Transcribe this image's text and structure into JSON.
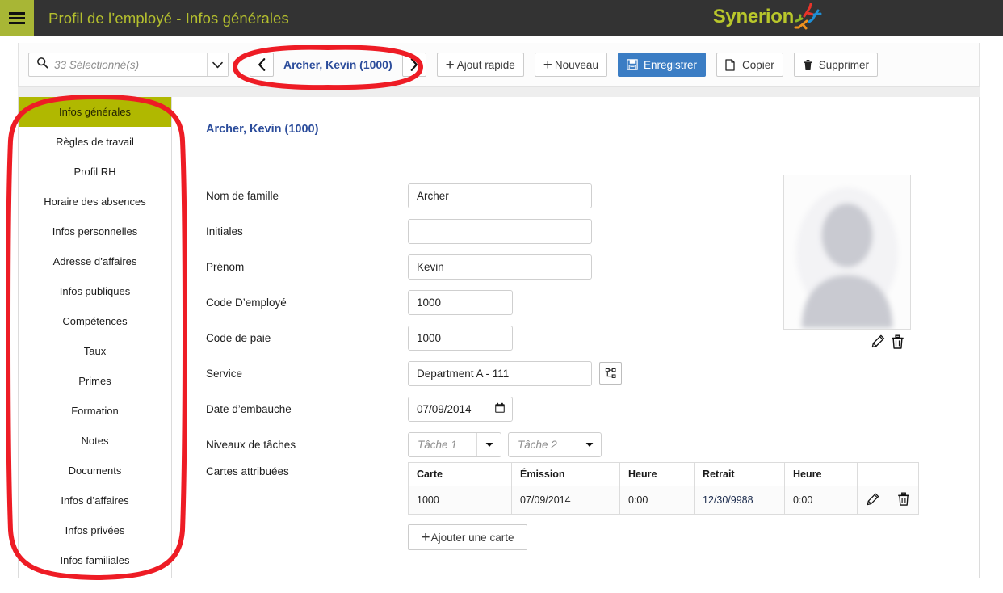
{
  "header": {
    "title": "Profil de l’employé - Infos générales",
    "menu_icon": "hamburger-icon",
    "logo_text": "Synerion",
    "colors": {
      "bar": "#333333",
      "accent": "#b0b800",
      "title_text": "#b4bf2e"
    }
  },
  "toolbar": {
    "search": {
      "placeholder": "33 Sélectionné(s)",
      "value": "",
      "icon": "search-icon"
    },
    "nav": {
      "prev_label": "‹",
      "next_label": "›",
      "employee": "Archer, Kevin (1000)"
    },
    "buttons": [
      {
        "label": "Ajout rapide",
        "icon": "plus-icon",
        "primary": false
      },
      {
        "label": "Nouveau",
        "icon": "plus-icon",
        "primary": false
      },
      {
        "label": "Enregistrer",
        "icon": "save-icon",
        "primary": true
      },
      {
        "label": "Copier",
        "icon": "copy-icon",
        "primary": false
      },
      {
        "label": "Supprimer",
        "icon": "trash-icon",
        "primary": false
      }
    ]
  },
  "sidebar": {
    "items": [
      {
        "label": "Infos générales",
        "active": true
      },
      {
        "label": "Règles de travail",
        "active": false
      },
      {
        "label": "Profil RH",
        "active": false
      },
      {
        "label": "Horaire des absences",
        "active": false
      },
      {
        "label": "Infos  personnelles",
        "active": false
      },
      {
        "label": "Adresse d’affaires",
        "active": false
      },
      {
        "label": "Infos publiques",
        "active": false
      },
      {
        "label": "Compétences",
        "active": false
      },
      {
        "label": "Taux",
        "active": false
      },
      {
        "label": "Primes",
        "active": false
      },
      {
        "label": "Formation",
        "active": false
      },
      {
        "label": "Notes",
        "active": false
      },
      {
        "label": "Documents",
        "active": false
      },
      {
        "label": "Infos d’affaires",
        "active": false
      },
      {
        "label": "Infos privées",
        "active": false
      },
      {
        "label": "Infos familiales",
        "active": false
      }
    ]
  },
  "main": {
    "record_title": "Archer, Kevin (1000)",
    "fields": {
      "nom_label": "Nom de famille",
      "nom_value": "Archer",
      "initiales_label": "Initiales",
      "initiales_value": "",
      "prenom_label": "Prénom",
      "prenom_value": "Kevin",
      "code_employe_label": "Code D’employé",
      "code_employe_value": "1000",
      "code_paie_label": "Code de paie",
      "code_paie_value": "1000",
      "service_label": "Service",
      "service_value": "Department A - 111",
      "service_button_icon": "org-chart-icon",
      "date_label": "Date d’embauche",
      "date_value": "07/09/2014",
      "date_icon": "calendar-icon",
      "taches_label": "Niveaux de tâches",
      "tache1_placeholder": "Tâche 1",
      "tache2_placeholder": "Tâche 2"
    },
    "photo": {
      "placeholder_icon": "person-avatar-icon",
      "edit_icon": "pencil-icon",
      "delete_icon": "trash-icon"
    },
    "cards": {
      "label": "Cartes attribuées",
      "columns": [
        "Carte",
        "Émission",
        "Heure",
        "Retrait",
        "Heure",
        "",
        ""
      ],
      "rows": [
        {
          "carte": "1000",
          "emission": "07/09/2014",
          "heure1": "0:00",
          "retrait": "12/30/9988",
          "heure2": "0:00",
          "edit_icon": "pencil-icon",
          "delete_icon": "trash-icon",
          "retrait_highlighted": true
        }
      ],
      "add_button": {
        "label": "Ajouter une carte",
        "icon": "plus-icon"
      },
      "highlight_color": "#c5d3ea"
    }
  },
  "annotations": {
    "color": "#ee1c25",
    "shapes": [
      "nav-group-oval",
      "sidebar-oval"
    ]
  }
}
